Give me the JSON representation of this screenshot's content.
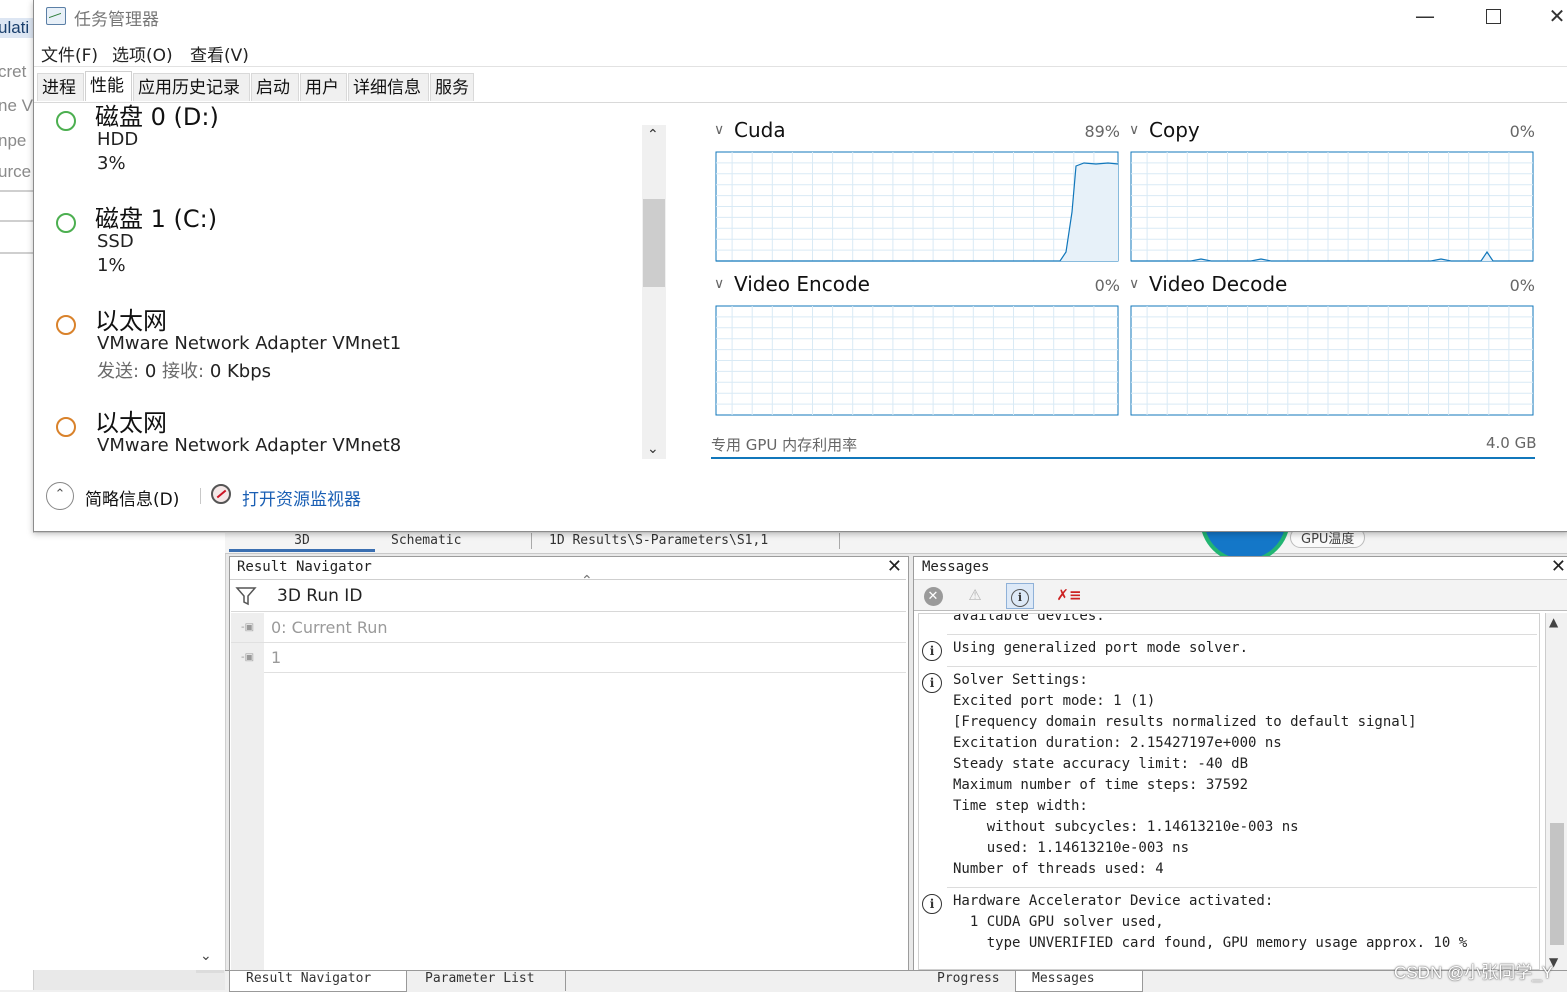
{
  "background_app": {
    "left_fragments": [
      "ulati",
      "cret",
      "ne V",
      "npe",
      "urce"
    ],
    "top_tabs": [
      "3D",
      "Schematic",
      "1D Results\\S-Parameters\\S1,1"
    ],
    "gpu_label": "GPU温度",
    "result_navigator": {
      "title": "Result Navigator",
      "column": "3D Run ID",
      "rows": [
        "0: Current Run",
        "1"
      ]
    },
    "messages": {
      "title": "Messages",
      "lines": [
        {
          "icon": false,
          "text": "available devices."
        },
        {
          "icon": true,
          "text": "Using generalized port mode solver."
        },
        {
          "icon": true,
          "text": "Solver Settings:"
        },
        {
          "icon": false,
          "text": "Excited port mode: 1 (1)"
        },
        {
          "icon": false,
          "text": "[Frequency domain results normalized to default signal]"
        },
        {
          "icon": false,
          "text": "Excitation duration: 2.15427197e+000 ns"
        },
        {
          "icon": false,
          "text": "Steady state accuracy limit: -40 dB"
        },
        {
          "icon": false,
          "text": "Maximum number of time steps: 37592"
        },
        {
          "icon": false,
          "text": "Time step width:"
        },
        {
          "icon": false,
          "text": "    without subcycles: 1.14613210e-003 ns"
        },
        {
          "icon": false,
          "text": "    used: 1.14613210e-003 ns"
        },
        {
          "icon": false,
          "text": "Number of threads used: 4"
        },
        {
          "icon": true,
          "text": "Hardware Accelerator Device activated:"
        },
        {
          "icon": false,
          "text": "  1 CUDA GPU solver used,"
        },
        {
          "icon": false,
          "text": "    type UNVERIFIED card found, GPU memory usage approx. 10 %"
        }
      ]
    },
    "bottom_tabs": [
      "Result Navigator",
      "Parameter List",
      "Progress",
      "Messages"
    ],
    "watermark": "CSDN @小张同学_Y"
  },
  "task_manager": {
    "title": "任务管理器",
    "menu": {
      "file": "文件(F)",
      "options": "选项(O)",
      "view": "查看(V)"
    },
    "tabs": [
      {
        "label": "进程",
        "active": false
      },
      {
        "label": "性能",
        "active": true
      },
      {
        "label": "应用历史记录",
        "active": false
      },
      {
        "label": "启动",
        "active": false
      },
      {
        "label": "用户",
        "active": false
      },
      {
        "label": "详细信息",
        "active": false
      },
      {
        "label": "服务",
        "active": false
      }
    ],
    "devices": [
      {
        "name": "磁盘 0 (D:)",
        "line1": "HDD",
        "line2": "3%",
        "color": "#4caf50"
      },
      {
        "name": "磁盘 1 (C:)",
        "line1": "SSD",
        "line2": "1%",
        "color": "#4caf50"
      },
      {
        "name": "以太网",
        "line1": "VMware Network Adapter VMnet1",
        "send_label": "发送:",
        "send": "0",
        "recv_label": "接收:",
        "recv": "0 Kbps",
        "color": "#d9822b"
      },
      {
        "name": "以太网",
        "line1": "VMware Network Adapter VMnet8",
        "color": "#d9822b"
      }
    ],
    "graphs": [
      {
        "name": "Cuda",
        "percent": "89%"
      },
      {
        "name": "Copy",
        "percent": "0%"
      },
      {
        "name": "Video Encode",
        "percent": "0%"
      },
      {
        "name": "Video Decode",
        "percent": "0%"
      }
    ],
    "graph_color": "#1177bb",
    "vram": {
      "label": "专用 GPU 内存利用率",
      "total": "4.0 GB"
    },
    "footer": {
      "fewer_details": "简略信息(D)",
      "open_resmon": "打开资源监视器"
    }
  }
}
